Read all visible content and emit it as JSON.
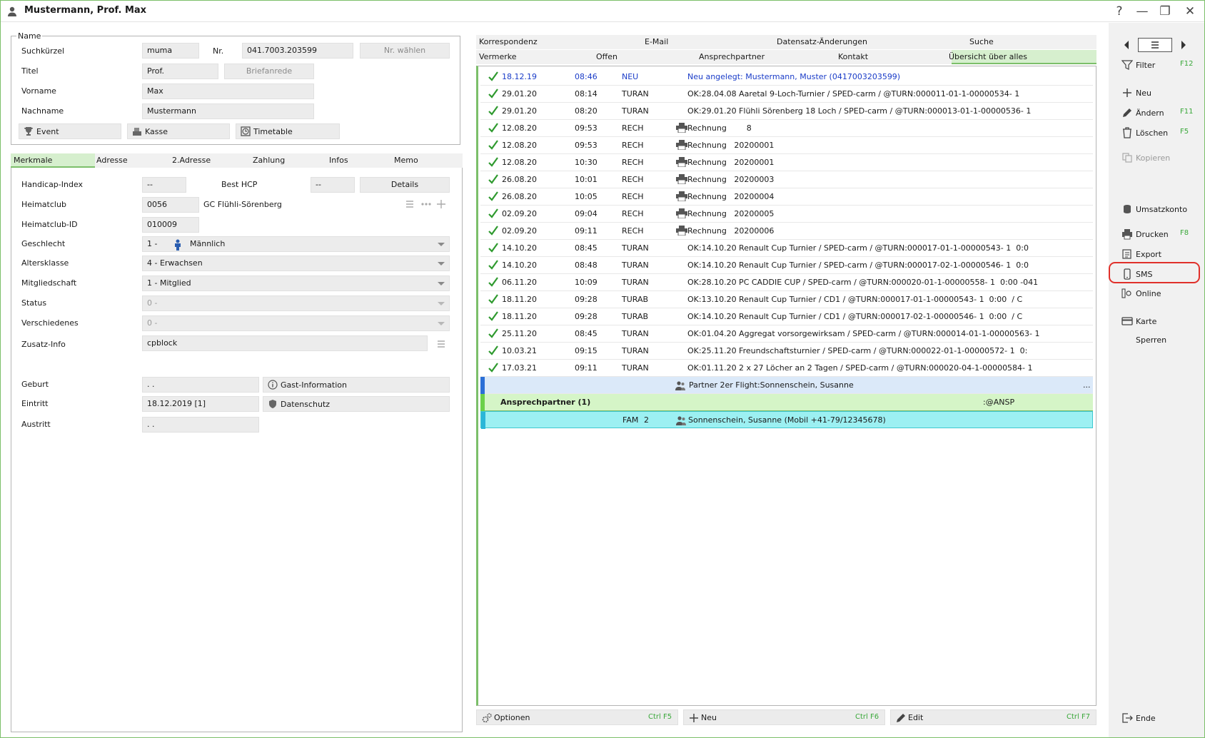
{
  "window": {
    "title": "Mustermann, Prof. Max"
  },
  "name_section": {
    "legend": "Name",
    "suchkuerzel_label": "Suchkürzel",
    "suchkuerzel_value": "muma",
    "nr_label": "Nr.",
    "nr_value": "041.7003.203599",
    "nr_waehlen_label": "Nr. wählen",
    "titel_label": "Titel",
    "titel_value": "Prof.",
    "briefanrede_label": "Briefanrede",
    "vorname_label": "Vorname",
    "vorname_value": "Max",
    "nachname_label": "Nachname",
    "nachname_value": "Mustermann",
    "event_label": "Event",
    "kasse_label": "Kasse",
    "timetable_label": "Timetable"
  },
  "left_tabs": [
    "Merkmale",
    "Adresse",
    "2.Adresse",
    "Zahlung",
    "Infos",
    "Memo"
  ],
  "merkmale": {
    "handicap_label": "Handicap-Index",
    "handicap_value": "--",
    "besthcp_label": "Best HCP",
    "besthcp_value": "--",
    "details_label": "Details",
    "heimatclub_label": "Heimatclub",
    "heimatclub_value": "0056",
    "heimatclub_name": "GC Flühli-Sörenberg",
    "heimatclub_id_label": "Heimatclub-ID",
    "heimatclub_id_value": "010009",
    "geschlecht_label": "Geschlecht",
    "geschlecht_code": "1 -",
    "geschlecht_value": "Männlich",
    "altersklasse_label": "Altersklasse",
    "altersklasse_value": "4 - Erwachsen",
    "mitgliedschaft_label": "Mitgliedschaft",
    "mitgliedschaft_value": "1 - Mitglied",
    "status_label": "Status",
    "status_value": "0 -",
    "verschiedenes_label": "Verschiedenes",
    "verschiedenes_value": "0 -",
    "zusatz_label": "Zusatz-Info",
    "zusatz_value": "cpblock",
    "geburt_label": "Geburt",
    "geburt_value": ". .",
    "gast_info_label": "Gast-Information",
    "eintritt_label": "Eintritt",
    "eintritt_value": "18.12.2019  [1]",
    "datenschutz_label": "Datenschutz",
    "austritt_label": "Austritt",
    "austritt_value": ". ."
  },
  "right_tabs_row1": [
    "Korrespondenz",
    "E-Mail",
    "Datensatz-Änderungen",
    "Suche"
  ],
  "right_tabs_row2": [
    "Vermerke",
    "Offen",
    "Ansprechpartner",
    "Kontakt",
    "Übersicht über alles"
  ],
  "entries": [
    {
      "date": "18.12.19",
      "time": "08:46",
      "type": "NEU",
      "printer": false,
      "text": "Neu angelegt: Mustermann, Muster (0417003203599)",
      "blue": true
    },
    {
      "date": "29.01.20",
      "time": "08:14",
      "type": "TURAN",
      "printer": false,
      "text": "OK:28.04.08 Aaretal 9-Loch-Turnier / SPED-carm / @TURN:000011-01-1-00000534- 1"
    },
    {
      "date": "29.01.20",
      "time": "08:20",
      "type": "TURAN",
      "printer": false,
      "text": "OK:29.01.20 Flühli Sörenberg 18 Loch / SPED-carm / @TURN:000013-01-1-00000536- 1"
    },
    {
      "date": "12.08.20",
      "time": "09:53",
      "type": "RECH",
      "printer": true,
      "text": "Rechnung        8"
    },
    {
      "date": "12.08.20",
      "time": "09:53",
      "type": "RECH",
      "printer": true,
      "text": "Rechnung   20200001"
    },
    {
      "date": "12.08.20",
      "time": "10:30",
      "type": "RECH",
      "printer": true,
      "text": "Rechnung   20200001"
    },
    {
      "date": "26.08.20",
      "time": "10:01",
      "type": "RECH",
      "printer": true,
      "text": "Rechnung   20200003"
    },
    {
      "date": "26.08.20",
      "time": "10:05",
      "type": "RECH",
      "printer": true,
      "text": "Rechnung   20200004"
    },
    {
      "date": "02.09.20",
      "time": "09:04",
      "type": "RECH",
      "printer": true,
      "text": "Rechnung   20200005"
    },
    {
      "date": "02.09.20",
      "time": "09:11",
      "type": "RECH",
      "printer": true,
      "text": "Rechnung   20200006"
    },
    {
      "date": "14.10.20",
      "time": "08:45",
      "type": "TURAN",
      "printer": false,
      "text": "OK:14.10.20 Renault Cup Turnier / SPED-carm / @TURN:000017-01-1-00000543- 1  0:0"
    },
    {
      "date": "14.10.20",
      "time": "08:48",
      "type": "TURAN",
      "printer": false,
      "text": "OK:14.10.20 Renault Cup Turnier / SPED-carm / @TURN:000017-02-1-00000546- 1  0:0"
    },
    {
      "date": "06.11.20",
      "time": "10:09",
      "type": "TURAN",
      "printer": false,
      "text": "OK:28.10.20 PC CADDIE CUP / SPED-carm / @TURN:000020-01-1-00000558- 1  0:00 -041"
    },
    {
      "date": "18.11.20",
      "time": "09:28",
      "type": "TURAB",
      "printer": false,
      "text": "OK:13.10.20 Renault Cup Turnier / CD1 / @TURN:000017-01-1-00000543- 1  0:00  / C"
    },
    {
      "date": "18.11.20",
      "time": "09:28",
      "type": "TURAB",
      "printer": false,
      "text": "OK:14.10.20 Renault Cup Turnier / CD1 / @TURN:000017-02-1-00000546- 1  0:00  / C"
    },
    {
      "date": "25.11.20",
      "time": "08:45",
      "type": "TURAN",
      "printer": false,
      "text": "OK:01.04.20 Aggregat vorsorgewirksam / SPED-carm / @TURN:000014-01-1-00000563- 1"
    },
    {
      "date": "10.03.21",
      "time": "09:15",
      "type": "TURAN",
      "printer": false,
      "text": "OK:25.11.20 Freundschaftsturnier / SPED-carm / @TURN:000022-01-1-00000572- 1  0:"
    },
    {
      "date": "17.03.21",
      "time": "09:11",
      "type": "TURAN",
      "printer": false,
      "text": "OK:01.11.20 2 x 27 Löcher an 2 Tagen / SPED-carm / @TURN:000020-04-1-00000584- 1"
    }
  ],
  "partner_row": {
    "text": "Partner 2er Flight:Sonnenschein, Susanne",
    "ellipsis": "..."
  },
  "ansp_row": {
    "title": "Ansprechpartner (1)",
    "code": ":@ANSP"
  },
  "fam_row": {
    "type": "FAM",
    "num": "2",
    "text": "Sonnenschein, Susanne (Mobil +41-79/12345678)"
  },
  "bottom": {
    "optionen_label": "Optionen",
    "optionen_key": "Ctrl F5",
    "neu_label": "Neu",
    "neu_key": "Ctrl F6",
    "edit_label": "Edit",
    "edit_key": "Ctrl F7"
  },
  "sidebar": {
    "filter": "Filter",
    "filter_key": "F12",
    "neu": "Neu",
    "aendern": "Ändern",
    "aendern_key": "F11",
    "loeschen": "Löschen",
    "loeschen_key": "F5",
    "kopieren": "Kopieren",
    "umsatzkonto": "Umsatzkonto",
    "drucken": "Drucken",
    "drucken_key": "F8",
    "export": "Export",
    "sms": "SMS",
    "online": "Online",
    "karte": "Karte",
    "sperren": "Sperren",
    "ende": "Ende"
  },
  "colors": {
    "accent_green": "#7cbf6a",
    "link_blue": "#1a3cc8",
    "highlight_red": "#e0302a",
    "fam_cyan": "#9cf0f2"
  }
}
